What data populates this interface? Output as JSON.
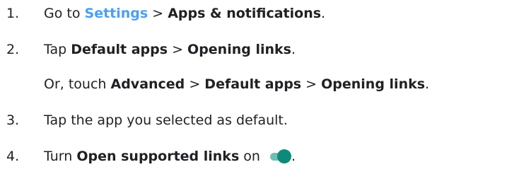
{
  "steps": [
    {
      "number": "1.",
      "t1": "Go to ",
      "link": "Settings",
      "t2": " > ",
      "b1": "Apps & notifications",
      "t3": "."
    },
    {
      "number": "2.",
      "t1": "Tap ",
      "b1": "Default apps",
      "t2": " > ",
      "b2": "Opening links",
      "t3": "."
    },
    {
      "t1": "Or, touch ",
      "b1": "Advanced",
      "t2": " > ",
      "b2": "Default apps",
      "t3": " > ",
      "b3": "Opening links",
      "t4": "."
    },
    {
      "number": "3.",
      "t1": "Tap the app you selected as default."
    },
    {
      "number": "4.",
      "t1": "Turn ",
      "b1": "Open supported links",
      "t2": " on ",
      "t3": ".",
      "toggle_icon": "toggle-on-icon",
      "toggle_color": "#0e8a7a"
    }
  ]
}
